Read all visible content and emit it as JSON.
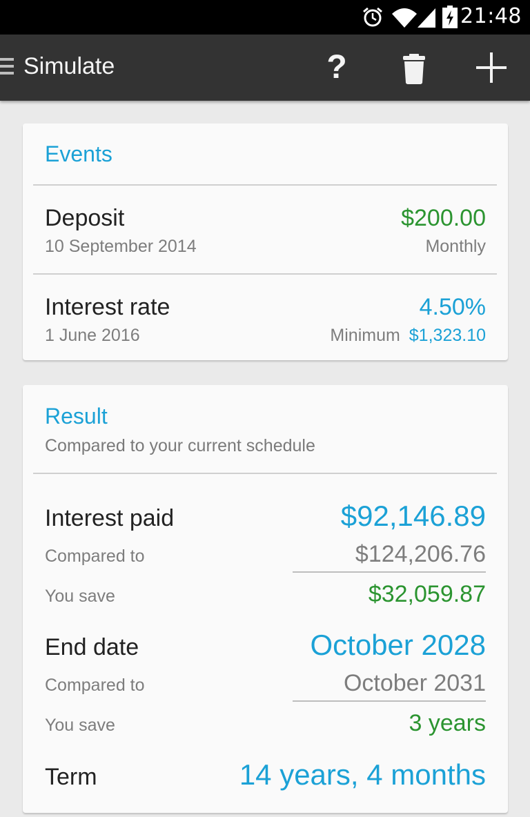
{
  "status_bar": {
    "time": "21:48",
    "icons": [
      "alarm-icon",
      "wifi-icon",
      "signal-icon",
      "battery-charging-icon"
    ]
  },
  "app_bar": {
    "title": "Simulate",
    "actions": {
      "help": "?",
      "delete_icon": "trash-icon",
      "add_icon": "plus-icon"
    }
  },
  "events": {
    "heading": "Events",
    "items": [
      {
        "title": "Deposit",
        "date": "10 September 2014",
        "value": "$200.00",
        "detail": "Monthly"
      },
      {
        "title": "Interest rate",
        "date": "1 June 2016",
        "value": "4.50%",
        "detail_label": "Minimum",
        "detail_value": "$1,323.10"
      }
    ]
  },
  "result": {
    "heading": "Result",
    "subtitle": "Compared to your current schedule",
    "interest_paid": {
      "label": "Interest paid",
      "value": "$92,146.89",
      "compared_label": "Compared to",
      "compared_value": "$124,206.76",
      "save_label": "You save",
      "save_value": "$32,059.87"
    },
    "end_date": {
      "label": "End date",
      "value": "October 2028",
      "compared_label": "Compared to",
      "compared_value": "October 2031",
      "save_label": "You save",
      "save_value": "3 years"
    },
    "term": {
      "label": "Term",
      "value": "14 years, 4 months"
    }
  },
  "colors": {
    "accent_blue": "#1ba1d6",
    "positive_green": "#2b9430",
    "app_bar": "#333333"
  }
}
